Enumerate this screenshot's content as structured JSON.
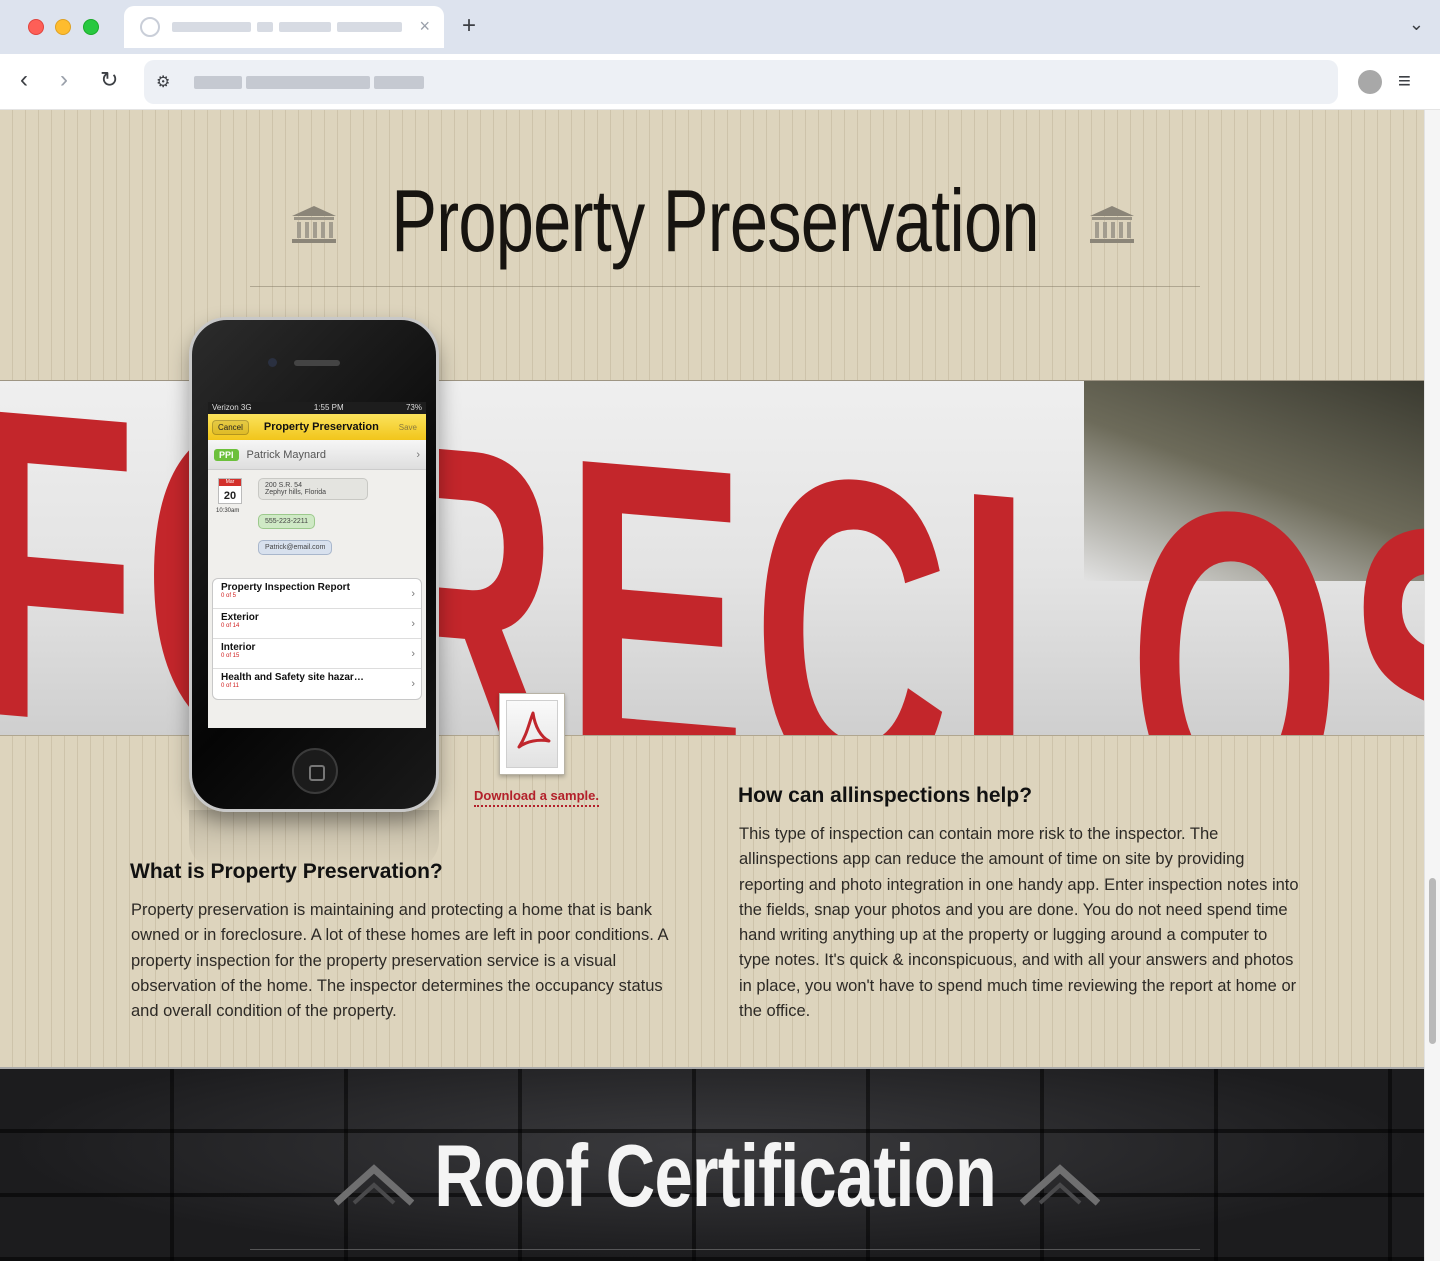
{
  "browser": {
    "tab_close": "×",
    "new_tab": "+",
    "tab_dropdown": "⌄",
    "back": "‹",
    "forward": "›",
    "reload": "↻",
    "site_settings": "⚙",
    "menu": "≡"
  },
  "page": {
    "title": "Property Preservation",
    "download_label": "Download a sample.",
    "what": {
      "heading": "What is Property Preservation?",
      "body": "Property preservation is maintaining and protecting a home that is bank owned or in foreclosure. A lot of these homes are left in poor conditions.  A property inspection for the property preservation service is a visual observation of the home.  The inspector determines the occupancy status and overall condition of the property."
    },
    "how": {
      "heading": "How can allinspections help?",
      "body": "This type of inspection can contain more risk to the inspector.  The allinspections app can reduce the amount of time on site by providing reporting and photo integration in one handy app.  Enter inspection notes into the fields, snap your photos and you are done.  You do not need spend time hand writing anything up at the property or lugging around a computer to type notes.  It's quick & inconspicuous, and with all your answers and photos in place, you won't have to spend much time reviewing the report at home or the office."
    },
    "banner_word": "FORECLOSURE",
    "next_section_title": "Roof Certification"
  },
  "phone": {
    "carrier": "Verizon 3G",
    "time": "1:55 PM",
    "battery": "73%",
    "nav": {
      "cancel": "Cancel",
      "title": "Property Preservation",
      "save": "Save"
    },
    "contact": {
      "badge": "PPI",
      "name": "Patrick Maynard"
    },
    "calendar": {
      "month": "Mar",
      "day": "20",
      "time": "10:30am"
    },
    "address_line1": "200 S.R. 54",
    "address_line2": "Zephyr hills, Florida",
    "phone_number": "555-223-2211",
    "email": "Patrick@email.com",
    "sections": [
      {
        "title": "Property Inspection Report",
        "progress": "0 of 5"
      },
      {
        "title": "Exterior",
        "progress": "0 of 14"
      },
      {
        "title": "Interior",
        "progress": "0 of 15"
      },
      {
        "title": "Health and Safety site hazar…",
        "progress": "0 of 11"
      }
    ]
  }
}
